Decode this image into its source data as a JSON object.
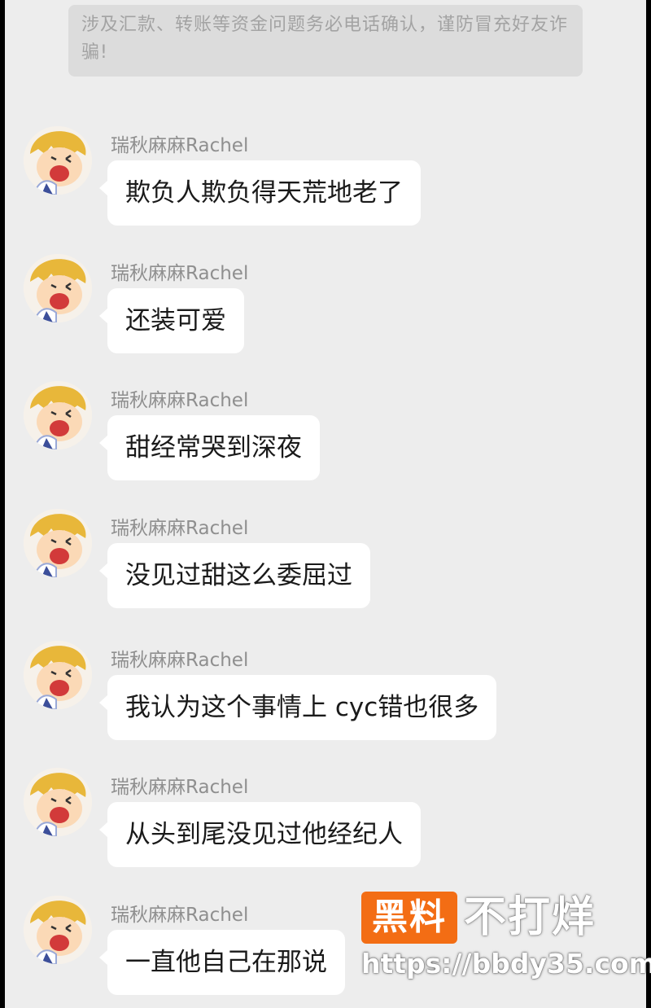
{
  "notice": {
    "text": "涉及汇款、转账等资金问题务必电话确认，谨防冒充好友诈骗!"
  },
  "messages": [
    {
      "sender": "瑞秋麻麻Rachel",
      "text": "欺负人欺负得天荒地老了"
    },
    {
      "sender": "瑞秋麻麻Rachel",
      "text": "还装可爱"
    },
    {
      "sender": "瑞秋麻麻Rachel",
      "text": "甜经常哭到深夜"
    },
    {
      "sender": "瑞秋麻麻Rachel",
      "text": "没见过甜这么委屈过"
    },
    {
      "sender": "瑞秋麻麻Rachel",
      "text": "我认为这个事情上 cyc错也很多"
    },
    {
      "sender": "瑞秋麻麻Rachel",
      "text": "从头到尾没见过他经纪人"
    },
    {
      "sender": "瑞秋麻麻Rachel",
      "text": "一直他自己在那说"
    }
  ],
  "watermark": {
    "badge": "黑料",
    "title": "不打烊",
    "url": "https://bbdy35.com"
  },
  "colors": {
    "background": "#ededed",
    "bubble": "#ffffff",
    "notice_bg": "#dcdcdc",
    "watermark_accent": "#f36d14"
  },
  "icons": {
    "avatar": "cartoon-boy-avatar"
  }
}
